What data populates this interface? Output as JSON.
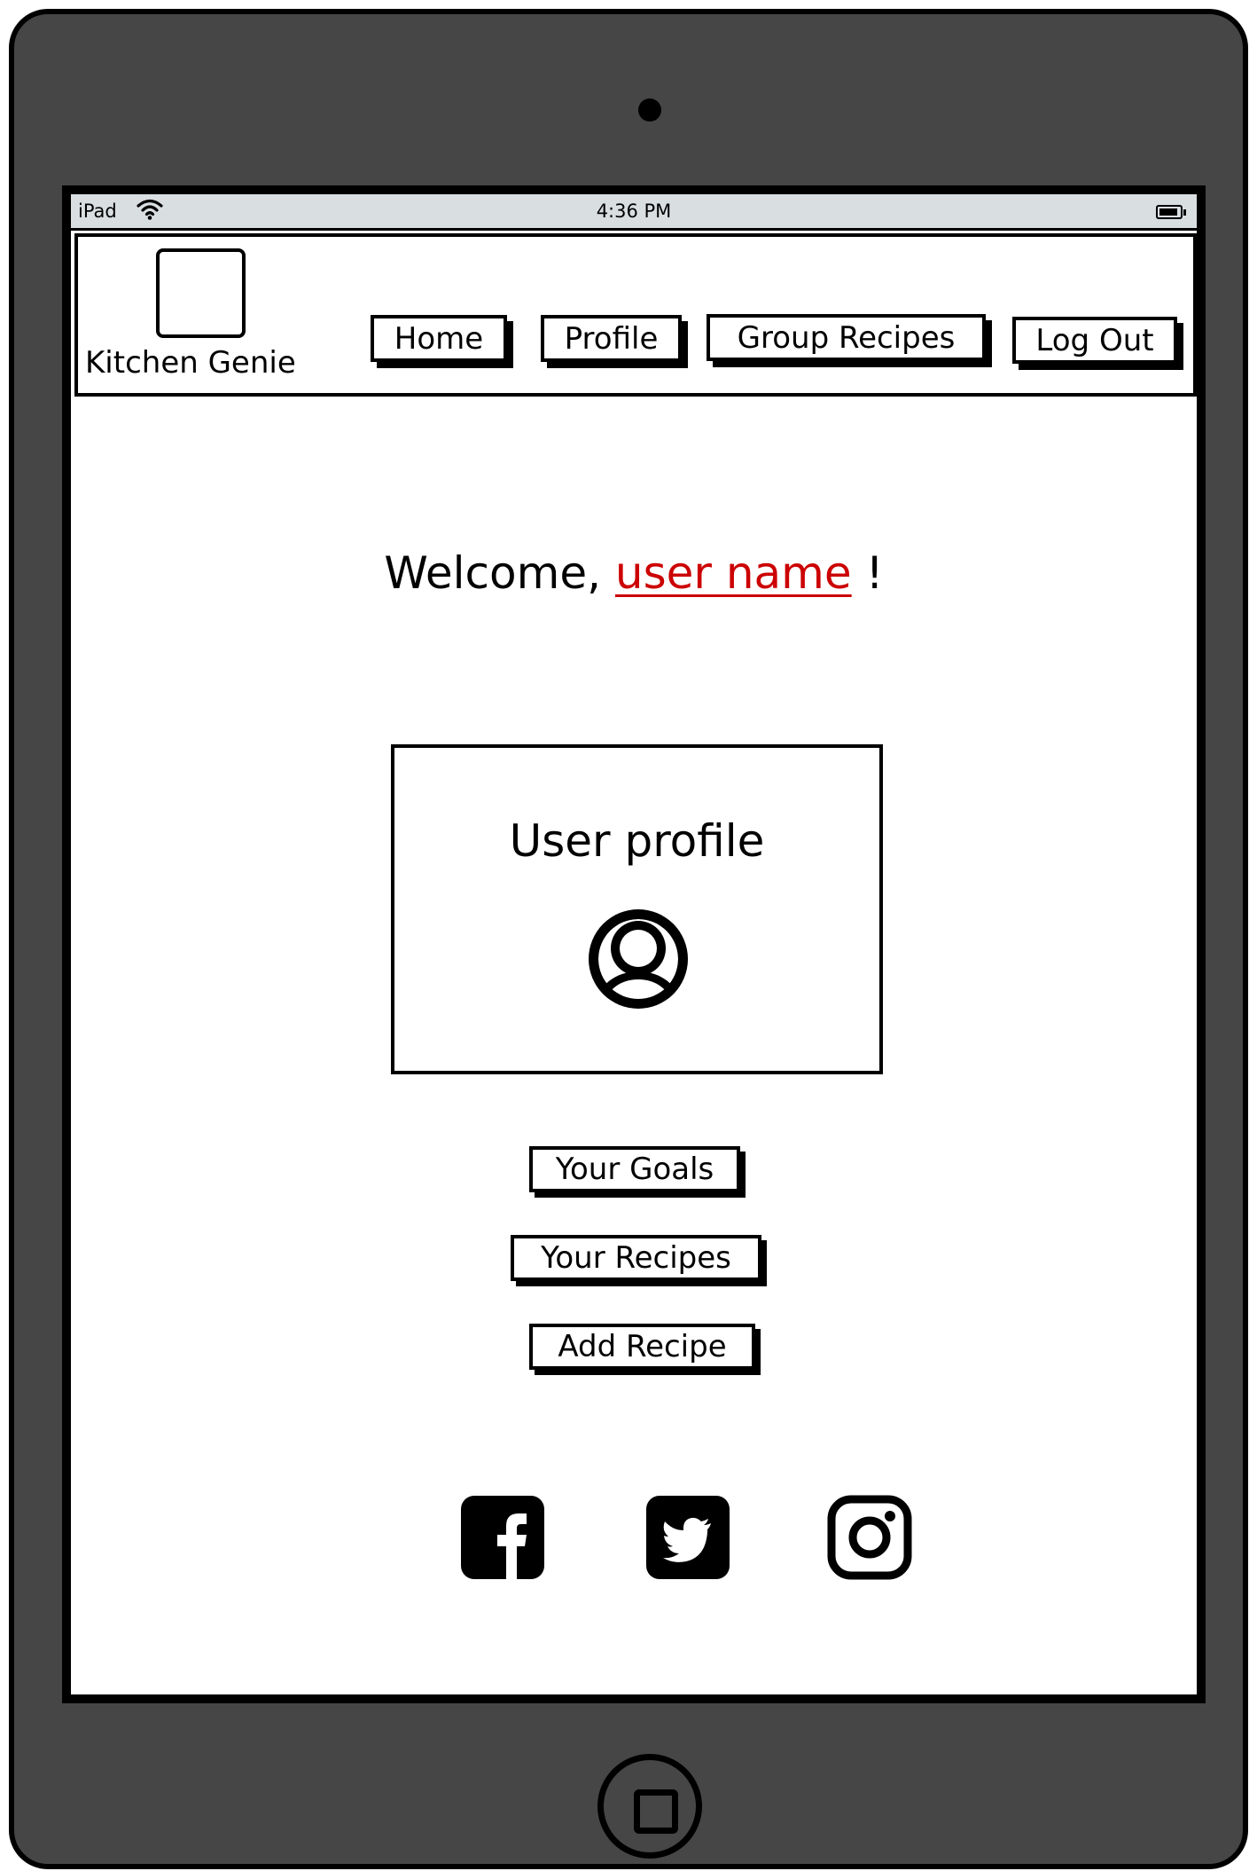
{
  "status_bar": {
    "device": "iPad",
    "time": "4:36 PM",
    "icons": [
      "wifi-icon",
      "battery-icon"
    ]
  },
  "header": {
    "brand": "Kitchen Genie",
    "logo": "logo-placeholder",
    "nav": [
      {
        "label": "Home"
      },
      {
        "label": "Profile"
      },
      {
        "label": "Group Recipes"
      },
      {
        "label": "Log Out"
      }
    ]
  },
  "main": {
    "welcome_prefix": "Welcome,",
    "user_name": "user name",
    "welcome_suffix": "!",
    "profile_card_title": "User profile",
    "avatar_icon": "user-avatar-icon",
    "actions": [
      {
        "label": "Your Goals"
      },
      {
        "label": "Your Recipes"
      },
      {
        "label": "Add Recipe"
      }
    ]
  },
  "social": [
    "facebook-icon",
    "twitter-icon",
    "instagram-icon"
  ],
  "colors": {
    "device_frame": "#464646",
    "status_bar": "#d9dee1",
    "link": "#cc0000"
  }
}
